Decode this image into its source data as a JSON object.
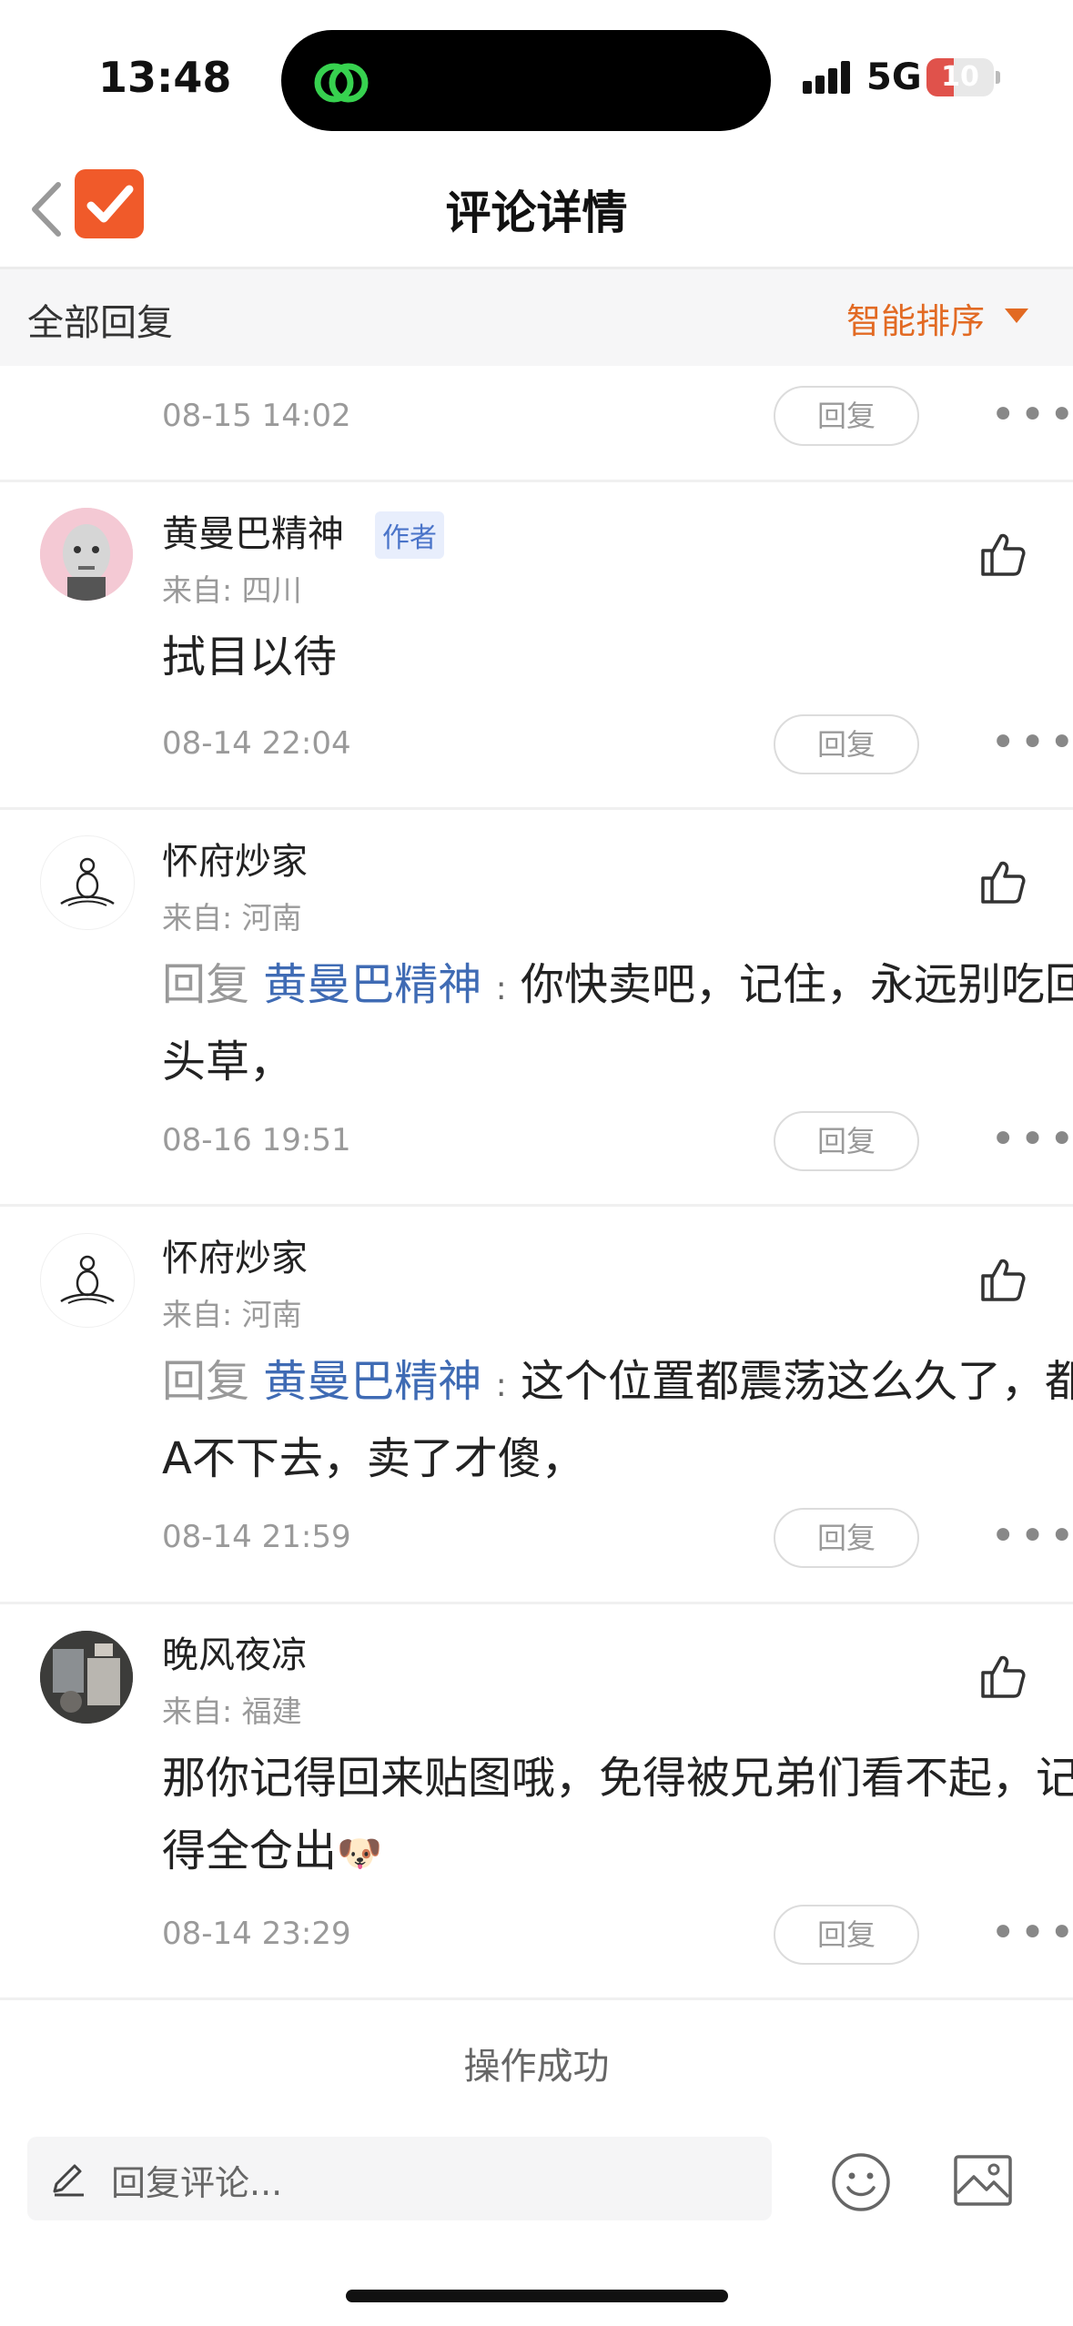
{
  "status_bar": {
    "time": "13:48",
    "network": "5G",
    "battery": "10",
    "battery_level": 0.1
  },
  "nav": {
    "title": "评论详情"
  },
  "filter": {
    "label": "全部回复",
    "sort_label": "智能排序"
  },
  "first_row": {
    "date": "08-15 14:02",
    "reply_label": "回复"
  },
  "comments": [
    {
      "name": "黄曼巴精神",
      "badge": "作者",
      "location": "来自: 四川",
      "text": "拭目以待",
      "date": "08-14 22:04",
      "reply_label": "回复"
    },
    {
      "name": "怀府炒家",
      "location": "来自: 河南",
      "reply_prefix": "回复",
      "mention": "黄曼巴精神",
      "colon": ":",
      "text": "你快卖吧，记住，永远别吃回头草，",
      "date": "08-16 19:51",
      "reply_label": "回复"
    },
    {
      "name": "怀府炒家",
      "location": "来自: 河南",
      "reply_prefix": "回复",
      "mention": "黄曼巴精神",
      "colon": ":",
      "text": "这个位置都震荡这么久了，都A不下去，卖了才傻，",
      "date": "08-14 21:59",
      "reply_label": "回复"
    },
    {
      "name": "晚风夜凉",
      "location": "来自: 福建",
      "text": "那你记得回来贴图哦，免得被兄弟们看不起，记得全仓出",
      "emoji": "🐶",
      "date": "08-14 23:29",
      "reply_label": "回复"
    }
  ],
  "toast": "操作成功",
  "compose": {
    "placeholder": "回复评论..."
  },
  "icons": {
    "back": "back-chevron-icon",
    "app_logo": "checkmark-app-icon",
    "like": "thumbs-up-icon",
    "more": "more-dots-icon",
    "compose": "pencil-icon",
    "emoji": "smiley-icon",
    "image": "image-icon"
  },
  "colors": {
    "accent": "#e26a23",
    "mention": "#3f6bb4",
    "logo": "#f05a2a"
  }
}
